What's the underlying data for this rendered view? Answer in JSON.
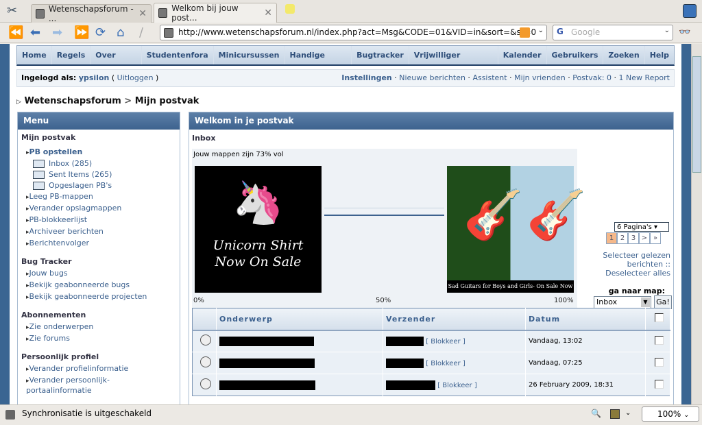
{
  "browser": {
    "tabs": [
      {
        "label": "Wetenschapsforum - ..."
      },
      {
        "label": "Welkom bij jouw post..."
      }
    ],
    "url": "http://www.wetenschapsforum.nl/index.php?act=Msg&CODE=01&VID=in&sort=&st=0",
    "search_placeholder": "Google"
  },
  "nav": [
    "Home",
    "Regels",
    "Over WSF",
    "Studentenfora",
    "Minicursussen",
    "Handige links"
  ],
  "nav_right": [
    "Bugtracker",
    "Vrijwilliger worden",
    "Kalender",
    "Gebruikers",
    "Zoeken",
    "Help"
  ],
  "login": {
    "label": "Ingelogd als:",
    "user": "ypsilon",
    "logout": "Uitloggen",
    "links": [
      "Instellingen",
      "Nieuwe berichten",
      "Assistent",
      "Mijn vrienden",
      "Postvak: 0",
      "1 New Report"
    ]
  },
  "breadcrumb": {
    "root": "Wetenschapsforum",
    "sep": ">",
    "current": "Mijn postvak"
  },
  "menu": {
    "title": "Menu",
    "sections": [
      {
        "title": "Mijn postvak",
        "compose": "PB opstellen",
        "folders": [
          "Inbox (285)",
          "Sent Items (265)",
          "Opgeslagen PB's"
        ],
        "items": [
          "Leeg PB-mappen",
          "Verander opslagmappen",
          "PB-blokkeerlijst",
          "Archiveer berichten",
          "Berichtenvolger"
        ]
      },
      {
        "title": "Bug Tracker",
        "items": [
          "Jouw bugs",
          "Bekijk geabonneerde bugs",
          "Bekijk geabonneerde projecten"
        ]
      },
      {
        "title": "Abonnementen",
        "items": [
          "Zie onderwerpen",
          "Zie forums"
        ]
      },
      {
        "title": "Persoonlijk profiel",
        "items": [
          "Verander profielinformatie",
          "Verander persoonlijk-portaalinformatie"
        ]
      }
    ]
  },
  "main": {
    "title": "Welkom in je postvak",
    "folder": "Inbox",
    "usage_text": "Jouw mappen zijn 73% vol",
    "usage_percent": 73,
    "ad_left": "Unicorn Shirt Now On Sale",
    "ad_right": "Sad Guitars for Boys and Girls- On Sale Now",
    "scale": [
      "0%",
      "50%",
      "100%"
    ],
    "pages_label": "6 Pagina's",
    "pages": [
      "1",
      "2",
      "3",
      ">",
      "»"
    ],
    "current_page": "1",
    "select_read": "Selecteer gelezen berichten",
    "sep": "::",
    "deselect": "Deselecteer alles",
    "goto_label": "ga naar map:",
    "goto_value": "Inbox",
    "go_button": "Ga!",
    "columns": [
      "Onderwerp",
      "Verzender",
      "Datum"
    ],
    "rows": [
      {
        "block": "[ Blokkeer ]",
        "date": "Vandaag, 13:02"
      },
      {
        "block": "[ Blokkeer ]",
        "date": "Vandaag, 07:25"
      },
      {
        "block": "[ Blokkeer ]",
        "date": "26 February 2009, 18:31"
      }
    ]
  },
  "status": {
    "text": "Synchronisatie is uitgeschakeld",
    "zoom": "100%"
  }
}
